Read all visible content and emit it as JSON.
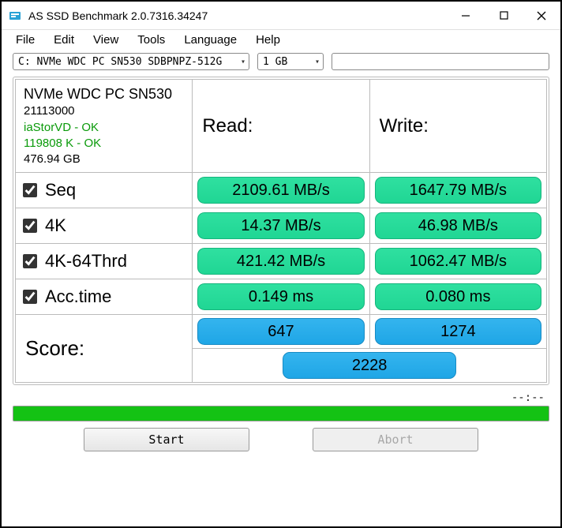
{
  "window": {
    "title": "AS SSD Benchmark 2.0.7316.34247"
  },
  "menu": {
    "file": "File",
    "edit": "Edit",
    "view": "View",
    "tools": "Tools",
    "language": "Language",
    "help": "Help"
  },
  "selectors": {
    "drive": "C: NVMe WDC PC SN530 SDBPNPZ-512G",
    "size": "1 GB"
  },
  "info": {
    "device_name": "NVMe WDC PC SN530",
    "firmware": "21113000",
    "driver_status": "iaStorVD - OK",
    "alignment": "119808 K - OK",
    "capacity": "476.94 GB"
  },
  "headers": {
    "read": "Read:",
    "write": "Write:",
    "score": "Score:"
  },
  "tests": {
    "seq": {
      "label": "Seq",
      "read": "2109.61 MB/s",
      "write": "1647.79 MB/s"
    },
    "fourk": {
      "label": "4K",
      "read": "14.37 MB/s",
      "write": "46.98 MB/s"
    },
    "fourk64": {
      "label": "4K-64Thrd",
      "read": "421.42 MB/s",
      "write": "1062.47 MB/s"
    },
    "acc": {
      "label": "Acc.time",
      "read": "0.149 ms",
      "write": "0.080 ms"
    }
  },
  "scores": {
    "read": "647",
    "write": "1274",
    "total": "2228"
  },
  "status": {
    "text": "--:--"
  },
  "buttons": {
    "start": "Start",
    "abort": "Abort"
  }
}
